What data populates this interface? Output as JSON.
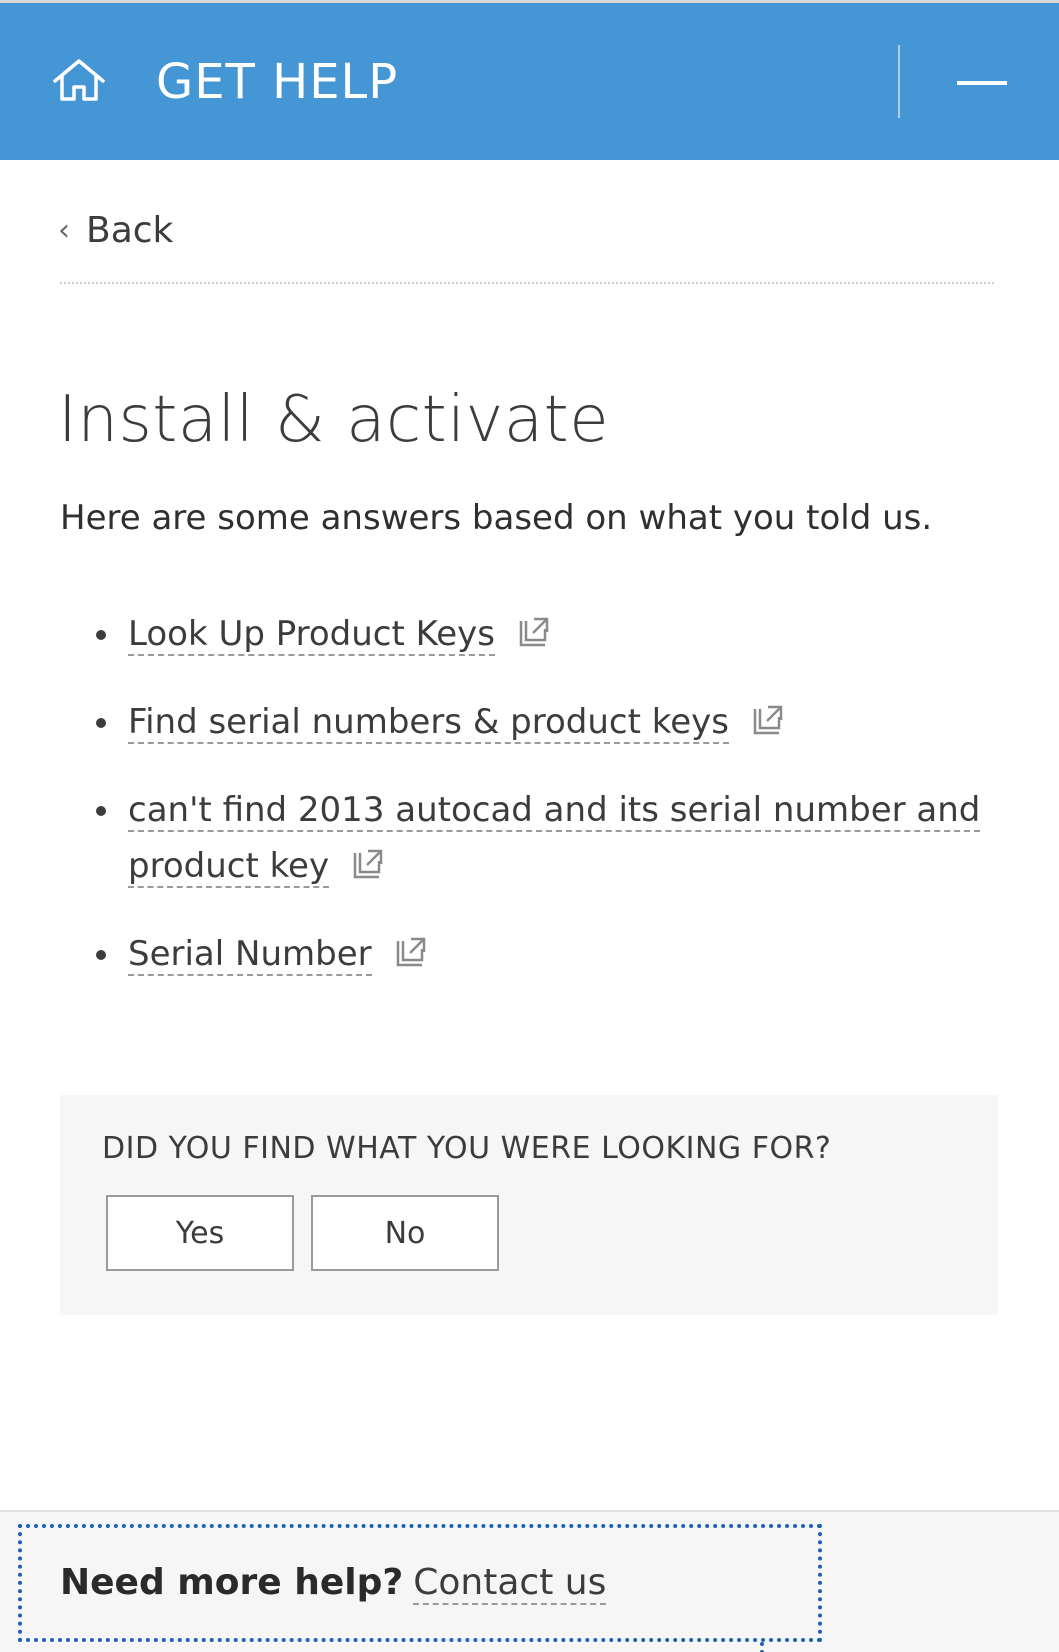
{
  "header": {
    "title": "GET HELP",
    "home_icon": "home-icon",
    "minimize_icon": "minimize-icon",
    "background": "#4596d4"
  },
  "nav": {
    "back_label": "Back",
    "back_icon": "chevron-left-icon"
  },
  "main": {
    "title": "Install & activate",
    "intro": "Here are some answers based on what you told us.",
    "answers": [
      {
        "label": "Look Up Product Keys",
        "icon": "external-link-icon"
      },
      {
        "label": "Find serial numbers & product keys",
        "icon": "external-link-icon"
      },
      {
        "label": "can't find 2013 autocad and its serial number and product key",
        "icon": "external-link-icon"
      },
      {
        "label": "Serial Number",
        "icon": "external-link-icon"
      }
    ]
  },
  "feedback": {
    "question": "DID YOU FIND WHAT YOU WERE LOOKING FOR?",
    "yes_label": "Yes",
    "no_label": "No"
  },
  "footer": {
    "prompt": "Need more help?",
    "contact_label": "Contact us",
    "focus_color": "#1f5fb8"
  }
}
